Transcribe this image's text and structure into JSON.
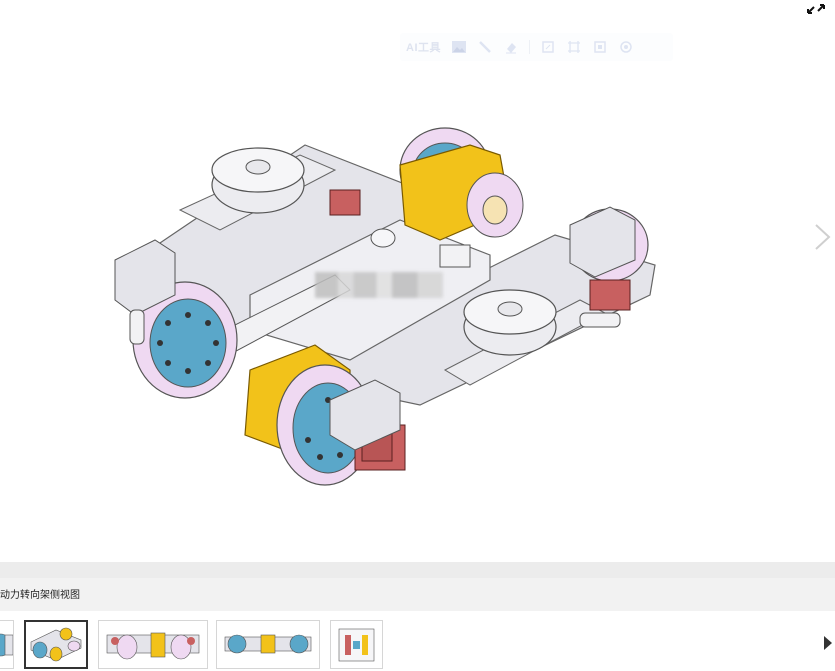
{
  "viewer": {
    "image_alt": "",
    "toolbar": {
      "ai_label": "AI工具",
      "icons": [
        "image-icon",
        "brush-icon",
        "eraser-icon",
        "crop-icon",
        "frame-icon",
        "layers-icon",
        "settings-icon"
      ]
    }
  },
  "caption": {
    "text": "动力转向架侧视图"
  },
  "thumbnails": [
    {
      "name": "bogie-partial"
    },
    {
      "name": "bogie-isometric"
    },
    {
      "name": "bogie-side-view"
    },
    {
      "name": "bogie-top-view"
    },
    {
      "name": "bogie-front-view"
    }
  ],
  "colors": {
    "motor_yellow": "#f2c21a",
    "wheel_hub_blue": "#5aa7c9",
    "frame_gray": "#e4e4ea",
    "wheel_lilac": "#efd9f2",
    "brake_red": "#c86060"
  }
}
